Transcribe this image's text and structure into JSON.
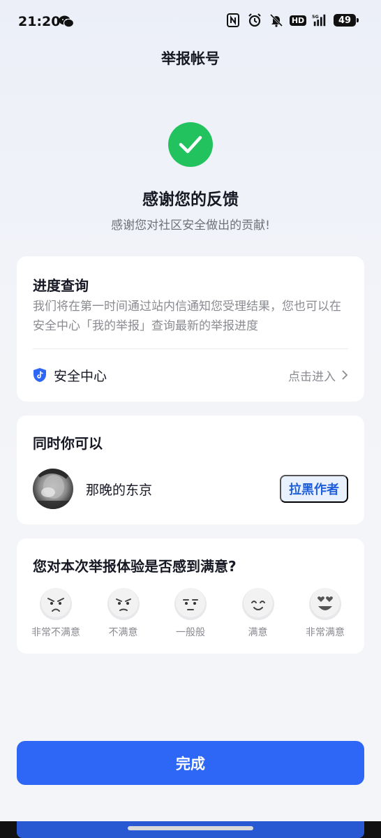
{
  "status_bar": {
    "time": "21:20",
    "hd": "HD",
    "battery": "49",
    "icons": [
      "wechat-icon",
      "nfc-icon",
      "alarm-icon",
      "mute-icon",
      "hd-icon",
      "signal-5g-icon",
      "battery-icon"
    ]
  },
  "header": {
    "title": "举报帐号"
  },
  "success": {
    "title": "感谢您的反馈",
    "subtitle": "感谢您对社区安全做出的贡献!",
    "icon_color": "#22c35e"
  },
  "progress": {
    "title": "进度查询",
    "description": "我们将在第一时间通过站内信通知您受理结果，您也可以在安全中心「我的举报」查询最新的举报进度",
    "security_center_label": "安全中心",
    "enter_label": "点击进入"
  },
  "also": {
    "title": "同时你可以",
    "user_name": "那晚的东京",
    "block_label": "拉黑作者"
  },
  "rating": {
    "question": "您对本次举报体验是否感到满意?",
    "options": [
      {
        "label": "非常不满意",
        "face": "very-dissatisfied-face-icon"
      },
      {
        "label": "不满意",
        "face": "dissatisfied-face-icon"
      },
      {
        "label": "一般般",
        "face": "neutral-face-icon"
      },
      {
        "label": "满意",
        "face": "satisfied-face-icon"
      },
      {
        "label": "非常满意",
        "face": "very-satisfied-face-icon"
      }
    ]
  },
  "footer": {
    "done_label": "完成"
  },
  "colors": {
    "accent": "#2e66f5",
    "link": "#1f5fd9",
    "success": "#22c35e"
  }
}
